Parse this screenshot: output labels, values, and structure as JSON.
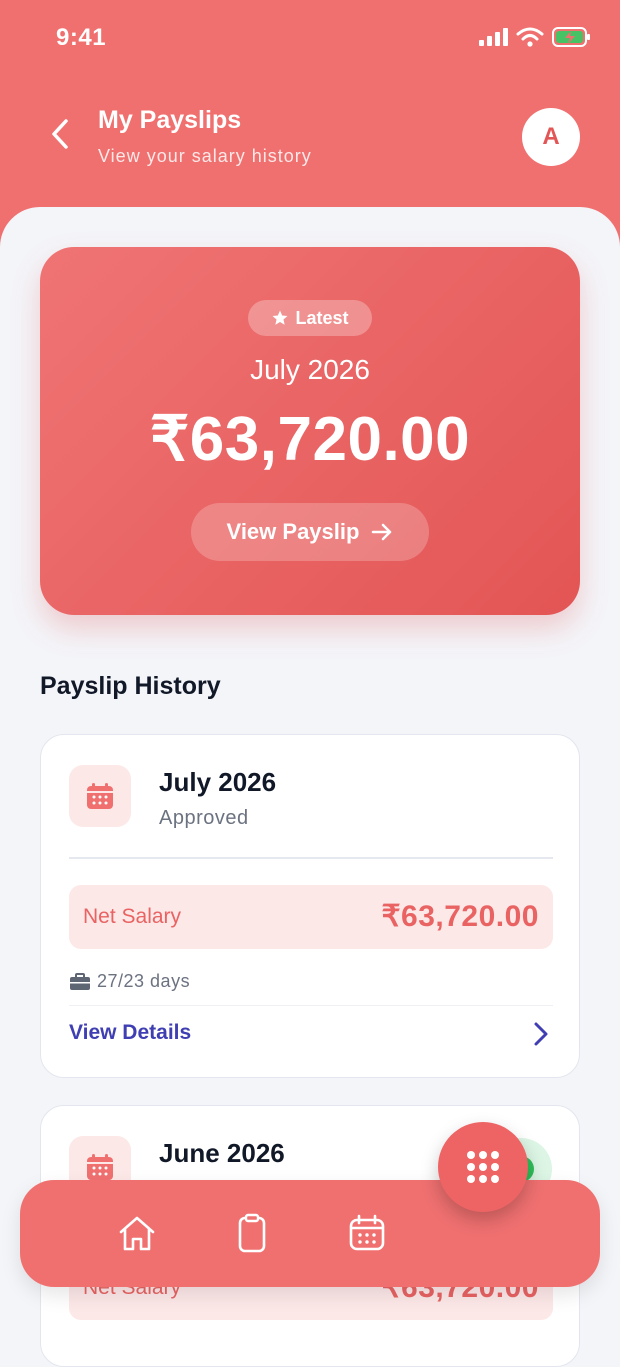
{
  "status_bar": {
    "time": "9:41"
  },
  "header": {
    "title": "My Payslips",
    "subtitle": "View your salary history",
    "avatar_initial": "A"
  },
  "hero": {
    "badge": "Latest",
    "month": "July 2026",
    "amount": "₹63,720.00",
    "button_label": "View Payslip"
  },
  "section_title": "Payslip History",
  "payslips": [
    {
      "month": "July 2026",
      "status": "Approved",
      "net_label": "Net Salary",
      "net_amount": "₹63,720.00",
      "days": "27/23 days",
      "action": "View Details"
    },
    {
      "month": "June 2026",
      "net_label": "Net Salary",
      "net_amount": "₹63,720.00"
    }
  ],
  "colors": {
    "primary": "#f07070",
    "accent": "#3f3fb3",
    "success": "#2fbf5a"
  },
  "nav": {
    "items": [
      "home-icon",
      "clipboard-icon",
      "calendar-icon"
    ],
    "fab_icon": "grid-icon"
  }
}
